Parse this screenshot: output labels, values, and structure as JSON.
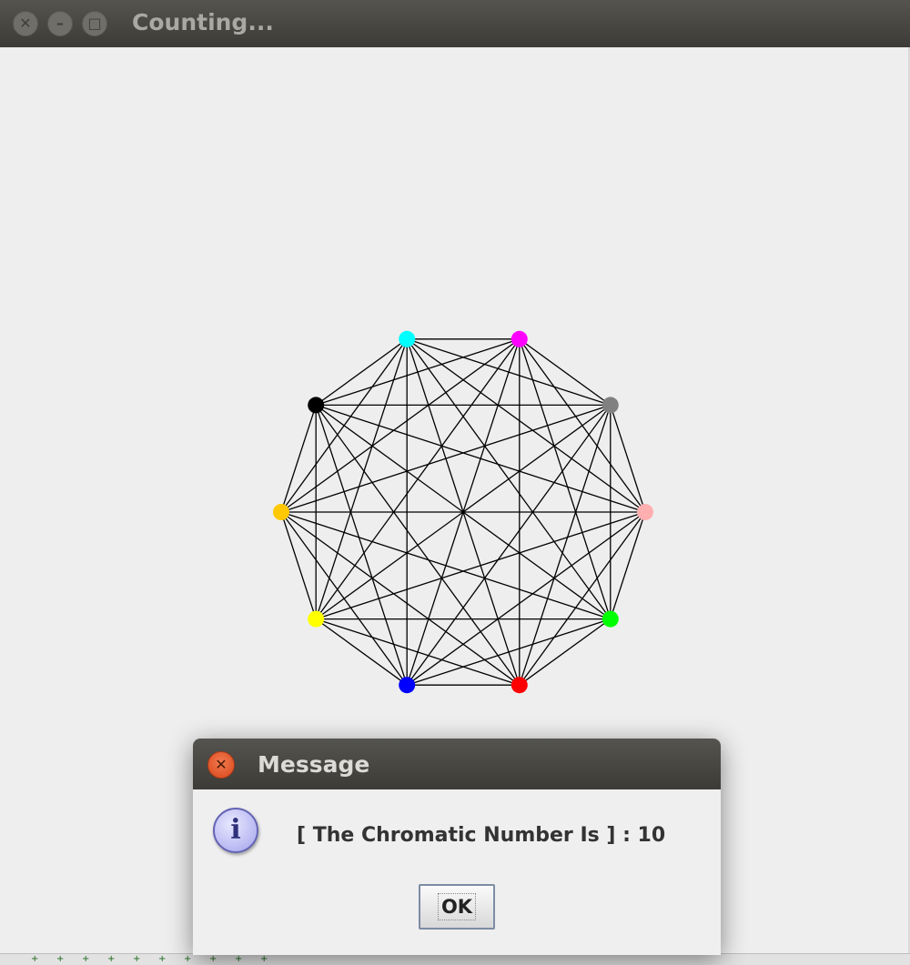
{
  "window": {
    "title": "Counting...",
    "buttons": {
      "close_glyph": "✕",
      "minimize_glyph": "–",
      "maximize_glyph": "□"
    }
  },
  "graph": {
    "edge_color": "#000000",
    "vertices": [
      {
        "name": "cyan",
        "color": "#00ffff"
      },
      {
        "name": "magenta",
        "color": "#ff00ff"
      },
      {
        "name": "gray",
        "color": "#808080"
      },
      {
        "name": "pink",
        "color": "#ffafaf"
      },
      {
        "name": "green",
        "color": "#00ff00"
      },
      {
        "name": "red",
        "color": "#ff0000"
      },
      {
        "name": "blue",
        "color": "#0000ff"
      },
      {
        "name": "yellow",
        "color": "#ffff00"
      },
      {
        "name": "orange",
        "color": "#ffc800"
      },
      {
        "name": "black",
        "color": "#000000"
      }
    ]
  },
  "dialog": {
    "title": "Message",
    "close_glyph": "✕",
    "icon": "info-icon",
    "icon_glyph": "i",
    "message": "[ The Chromatic Number Is ] : 10",
    "ok_label": "OK"
  }
}
